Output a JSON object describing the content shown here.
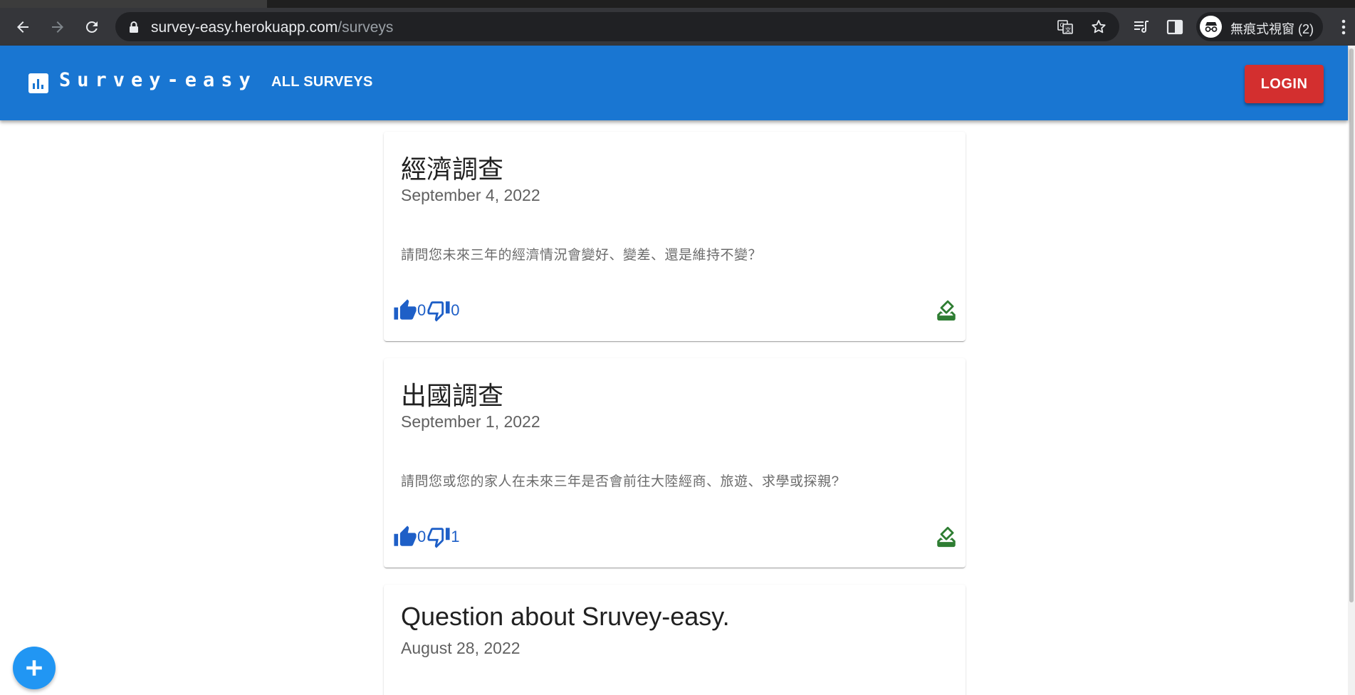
{
  "browser": {
    "url_host": "survey-easy.herokuapp.com",
    "url_path": "/surveys",
    "profile_label": "無痕式視窗 (2)"
  },
  "app_bar": {
    "brand": "Survey-easy",
    "nav_all_surveys": "ALL SURVEYS",
    "login_label": "LOGIN",
    "brand_color": "#1976d2",
    "login_color": "#d32f2f"
  },
  "surveys": [
    {
      "title": "經濟調查",
      "date": "September 4, 2022",
      "question": "請問您未來三年的經濟情況會變好、變差、還是維持不變？",
      "likes": "0",
      "dislikes": "0"
    },
    {
      "title": "出國調查",
      "date": "September 1, 2022",
      "question": "請問您或您的家人在未來三年是否會前往大陸經商、旅遊、求學或探親?",
      "likes": "0",
      "dislikes": "1"
    },
    {
      "title": "Question about Sruvey-easy.",
      "date": "August 28, 2022"
    }
  ],
  "icons": {
    "brand": "bar-chart-icon",
    "like": "thumb-up-icon",
    "dislike": "thumb-down-icon",
    "take_survey": "how-to-vote-icon",
    "fab": "add-icon"
  },
  "colors": {
    "like_blue": "#1e5fc7",
    "vote_green": "#2e7d32",
    "fab_blue": "#2196f3"
  }
}
